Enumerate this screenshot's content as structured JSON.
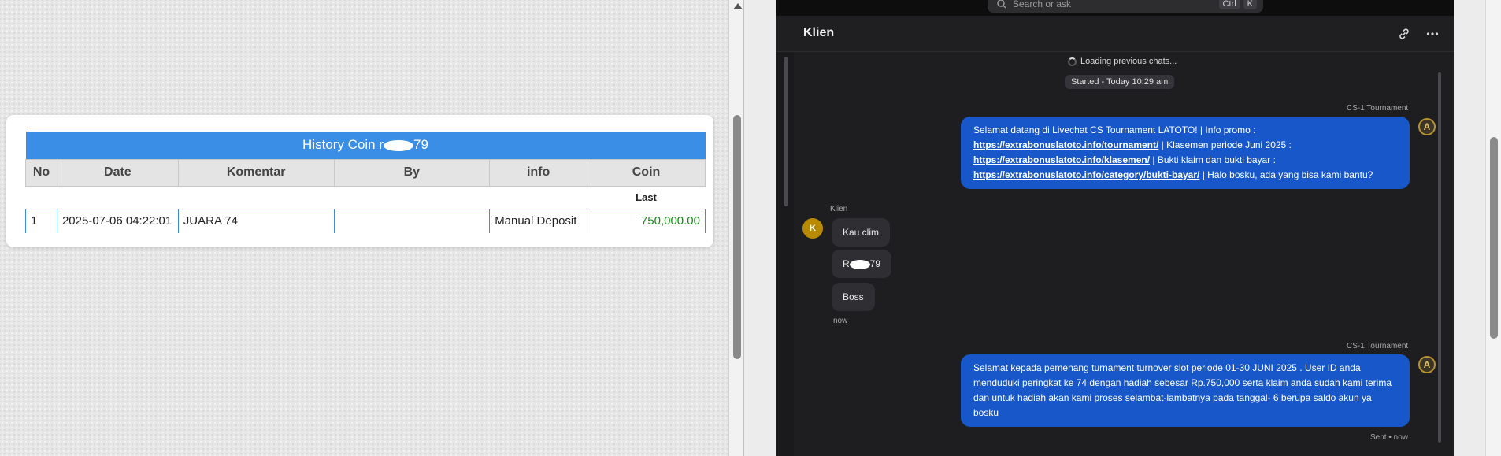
{
  "left": {
    "table": {
      "title_prefix": "History Coin r",
      "title_suffix": "79",
      "headers": [
        "No",
        "Date",
        "Komentar",
        "By",
        "info",
        "Coin"
      ],
      "sub_header": "Last",
      "rows": [
        {
          "no": "1",
          "date": "2025-07-06 04:22:01",
          "komentar": "JUARA 74",
          "by": "",
          "info": "Manual Deposit",
          "coin": "750,000.00"
        }
      ]
    }
  },
  "chat": {
    "search_placeholder": "Search or ask",
    "kbd_1": "Ctrl",
    "kbd_2": "K",
    "title": "Klien",
    "loading_text": "Loading previous chats...",
    "started_text": "Started - Today 10:29 am",
    "agent_name": "CS-1 Tournament",
    "client_name": "Klien",
    "client_initial": "K",
    "message1": {
      "t1": "Selamat datang di Livechat CS Tournament LATOTO! | Info promo :",
      "l1": "https://extrabonuslatoto.info/tournament/",
      "t2": "| Klasemen periode Juni 2025 :",
      "l2": "https://extrabonuslatoto.info/klasemen/",
      "t3": "| Bukti klaim dan bukti bayar :",
      "l3": "https://extrabonuslatoto.info/category/bukti-bayar/",
      "t4": "| Halo bosku, ada yang bisa kami bantu?"
    },
    "client_messages": [
      "Kau clim",
      "79",
      "Boss"
    ],
    "client_msg2_prefix": "R",
    "client_time": "now",
    "message2": "Selamat kepada pemenang turnament turnover slot periode 01-30 JUNI 2025 . User ID anda menduduki peringkat ke 74 dengan hadiah sebesar Rp.750,000 serta klaim anda sudah kami terima dan untuk hadiah akan kami proses selambat-lambatnya pada tanggal- 6 berupa saldo akun ya bosku",
    "sent_status": "Sent • now",
    "agent_avatar_letter": "A"
  }
}
